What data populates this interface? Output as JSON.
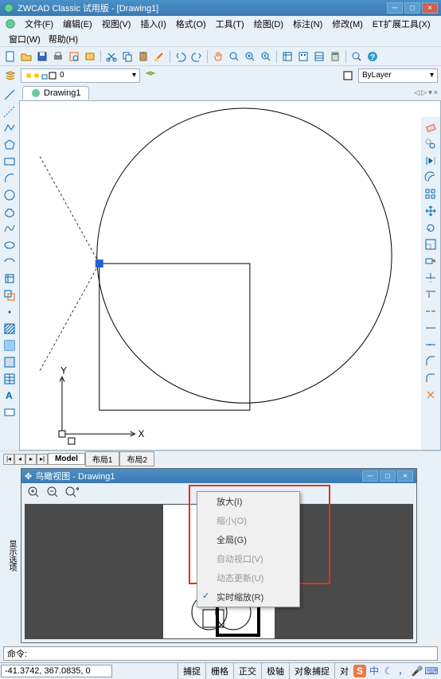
{
  "title": "ZWCAD Classic 试用版 - [Drawing1]",
  "menu": [
    "文件(F)",
    "编辑(E)",
    "视图(V)",
    "插入(I)",
    "格式(O)",
    "工具(T)",
    "绘图(D)",
    "标注(N)",
    "修改(M)",
    "ET扩展工具(X)"
  ],
  "menu2": [
    "窗口(W)",
    "帮助(H)"
  ],
  "layer": {
    "name": "0",
    "bylayer": "ByLayer"
  },
  "doc_tab": "Drawing1",
  "model_tabs": {
    "model": "Model",
    "layout1": "布局1",
    "layout2": "布局2"
  },
  "aerial": {
    "title": "鸟瞰视图 - Drawing1"
  },
  "context_menu": [
    {
      "label": "放大(I)",
      "enabled": true
    },
    {
      "label": "缩小(O)",
      "enabled": false
    },
    {
      "label": "全局(G)",
      "enabled": true
    },
    {
      "label": "自动视口(V)",
      "enabled": false
    },
    {
      "label": "动态更新(U)",
      "enabled": false
    },
    {
      "label": "实时缩放(R)",
      "enabled": true,
      "checked": true
    }
  ],
  "cmd": {
    "prompt": "命令:"
  },
  "status": {
    "coords": "-41.3742, 367.0835, 0",
    "snap": "捕捉",
    "grid": "栅格",
    "ortho": "正交",
    "polar": "极轴",
    "osnap": "对象捕捉",
    "otrack": "对"
  },
  "ime": {
    "s": "S",
    "zhong": "中"
  },
  "sidebar_label": "显示选项"
}
